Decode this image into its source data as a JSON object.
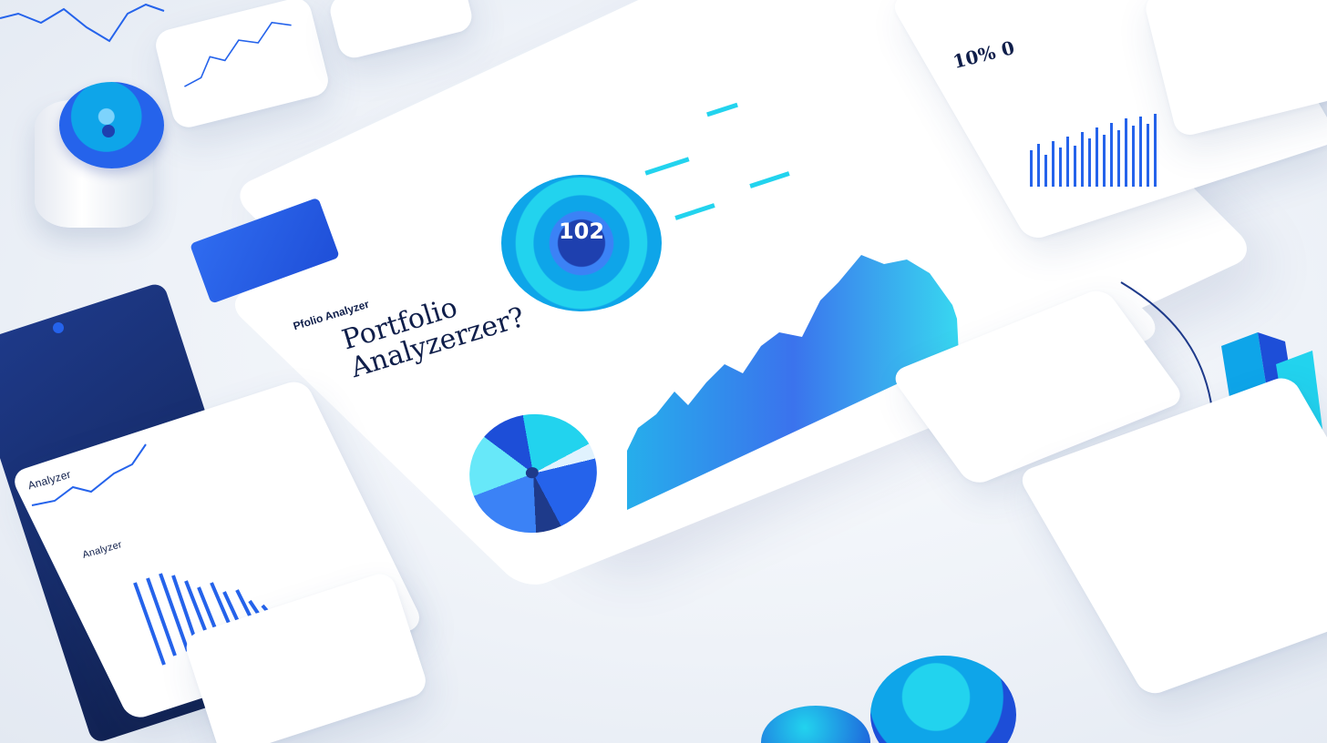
{
  "main": {
    "brand": "Pfolio Analyzer",
    "title_line1": "Portfolio",
    "title_line2": "Analyzerzer?",
    "gauge_value": "102",
    "header_label": "Portfolio Analyzer"
  },
  "top_right_card": {
    "value": "10% 0"
  },
  "left_card": {
    "heading": "Analyzer",
    "subheading": "Analyzer"
  },
  "colors": {
    "accent": "#2563eb",
    "cyan": "#22d3ee",
    "navy": "#0f1e4a"
  },
  "icons": [
    "toggle-knob-icon",
    "gauge-icon",
    "donut-chart-icon",
    "area-chart-icon",
    "bar-chart-icon"
  ]
}
